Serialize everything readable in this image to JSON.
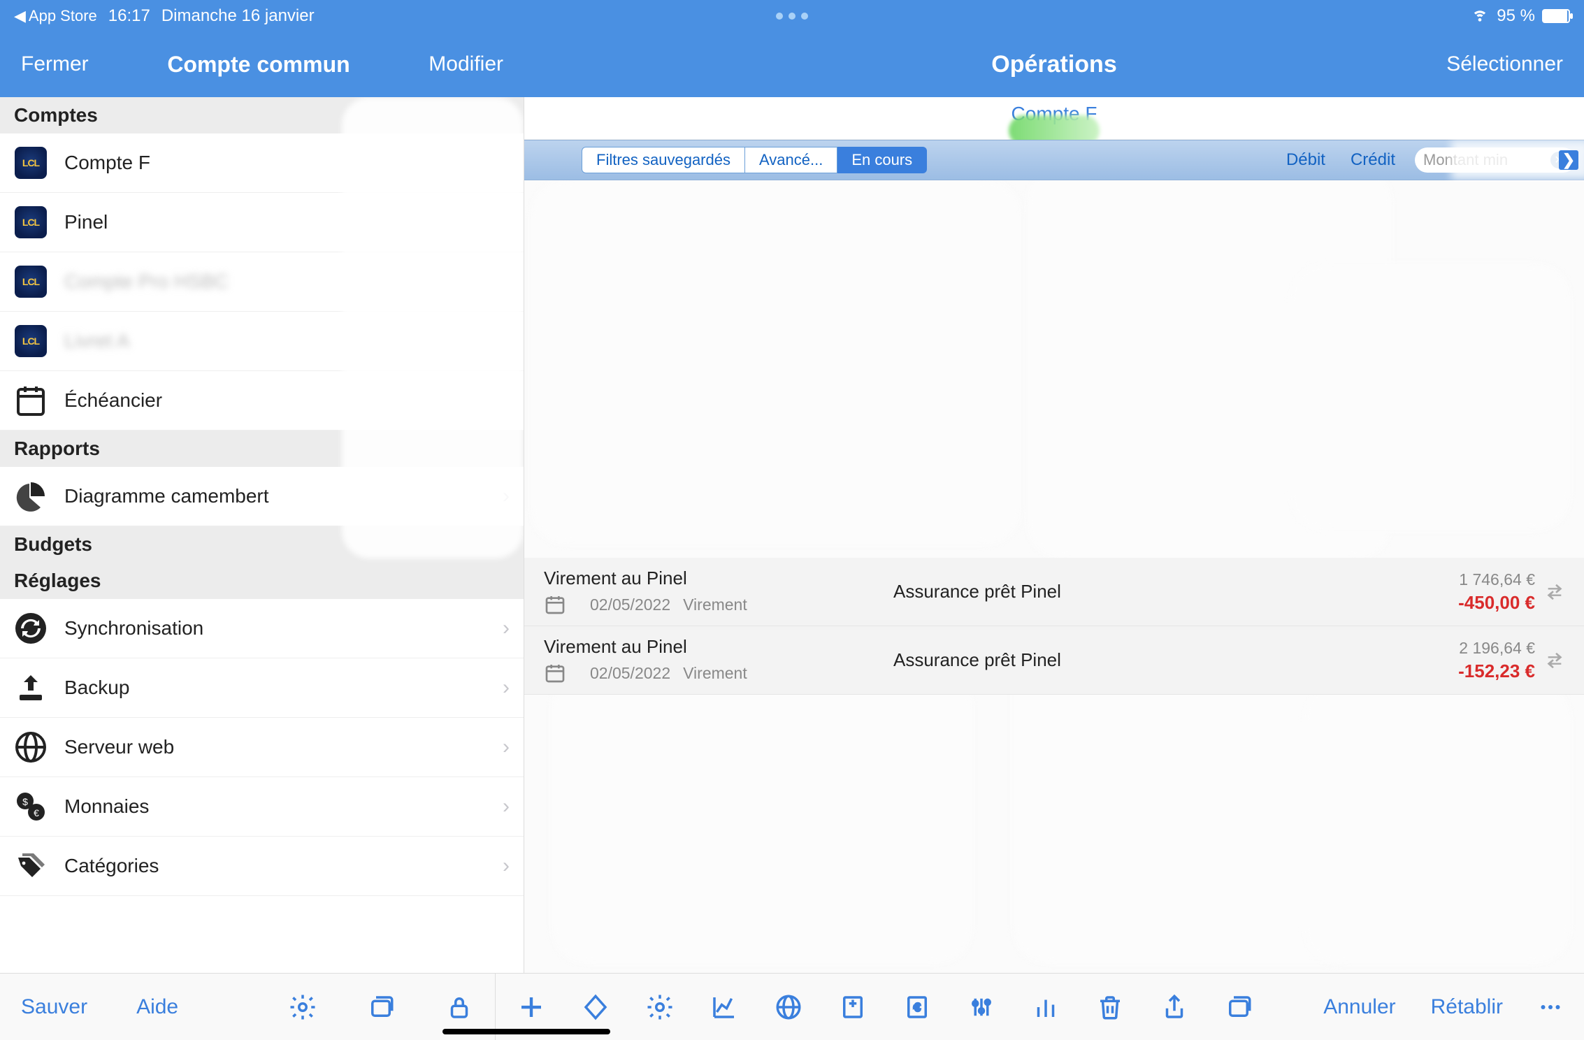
{
  "status": {
    "back_app": "App Store",
    "time": "16:17",
    "date": "Dimanche 16 janvier",
    "battery": "95 %"
  },
  "nav": {
    "left_close": "Fermer",
    "left_title": "Compte commun",
    "left_edit": "Modifier",
    "right_title": "Opérations",
    "right_select": "Sélectionner"
  },
  "sidebar": {
    "sections": {
      "accounts": "Comptes",
      "reports": "Rapports",
      "budgets": "Budgets",
      "settings": "Réglages"
    },
    "accounts": [
      {
        "label": "Compte F"
      },
      {
        "label": "Pinel"
      },
      {
        "label": "Compte Pro HSBC"
      },
      {
        "label": "Livret A"
      }
    ],
    "scheduler": "Échéancier",
    "pie": "Diagramme camembert",
    "settings_items": {
      "sync": "Synchronisation",
      "backup": "Backup",
      "web": "Serveur web",
      "currency": "Monnaies",
      "category": "Catégories"
    }
  },
  "content": {
    "account_name": "Compte F",
    "filters": {
      "saved": "Filtres sauvegardés",
      "advanced": "Avancé...",
      "current": "En cours",
      "debit": "Débit",
      "credit": "Crédit",
      "amount_placeholder": "Montant min"
    },
    "ops": [
      {
        "title": "Virement au Pinel",
        "date": "02/05/2022",
        "type": "Virement",
        "desc": "Assurance prêt Pinel",
        "balance": "1 746,64 €",
        "amount": "-450,00 €"
      },
      {
        "title": "Virement au Pinel",
        "date": "02/05/2022",
        "type": "Virement",
        "desc": "Assurance prêt Pinel",
        "balance": "2 196,64 €",
        "amount": "-152,23 €"
      }
    ]
  },
  "toolbar": {
    "save": "Sauver",
    "help": "Aide",
    "undo": "Annuler",
    "redo": "Rétablir"
  }
}
